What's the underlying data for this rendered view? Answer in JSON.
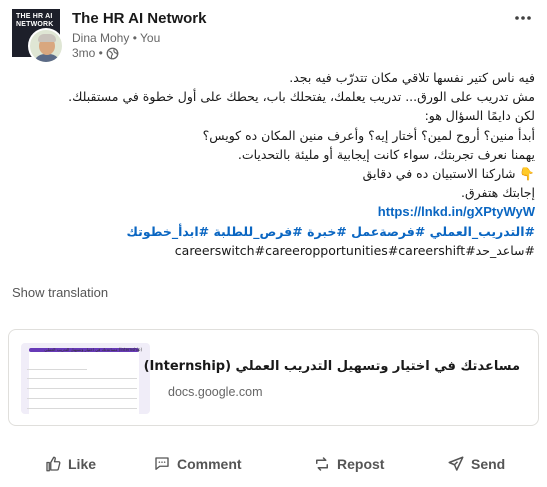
{
  "post": {
    "company_name": "The HR AI Network",
    "author_line": "Dina Mohy • You",
    "time": "3mo •",
    "more_icon": "ellipsis-icon",
    "globe_icon": "globe-icon",
    "logo_text": [
      "THE HR AI",
      "NETWORK"
    ],
    "body_lines": [
      "فيه ناس كتير نفسها تلاقي مكان تتدرّب فيه بجد.",
      "مش تدريب على الورق... تدريب يعلمك، يفتحلك باب، يحطك على أول خطوة في مستقبلك.",
      "لكن دايمًا السؤال هو:",
      "أبدأ منين؟ أروح لمين؟ أختار إيه؟ وأعرف منين المكان ده كويس؟",
      "يهمنا نعرف تجربتك، سواء كانت إيجابية أو مليئة بالتحديات.",
      "👇 شاركنا الاستبيان ده في دقايق",
      "إجابتك هتفرق."
    ],
    "link": "https://lnkd.in/gXPtyWyW",
    "hashtags_ar": "#التدريب_العملي #فرصةعمل #خبرة #فرص_للطلبة #ابدأ_خطوتك",
    "hashtags_mixed": "#ساعد_حد#careerswitch#careeropportunities#careershift",
    "show_translation": "Show translation"
  },
  "link_card": {
    "title": "مساعدتك في اختيار وتسهيل التدريب العملي (Internship)",
    "domain": "docs.google.com",
    "thumb_caption": "مساعدتك في اختيار وتسهيل التدريب العملي (Internship)"
  },
  "actions": {
    "like": "Like",
    "comment": "Comment",
    "repost": "Repost",
    "send": "Send"
  },
  "colors": {
    "link": "#0a66c2",
    "muted": "#666666",
    "form_accent": "#673ab7"
  }
}
